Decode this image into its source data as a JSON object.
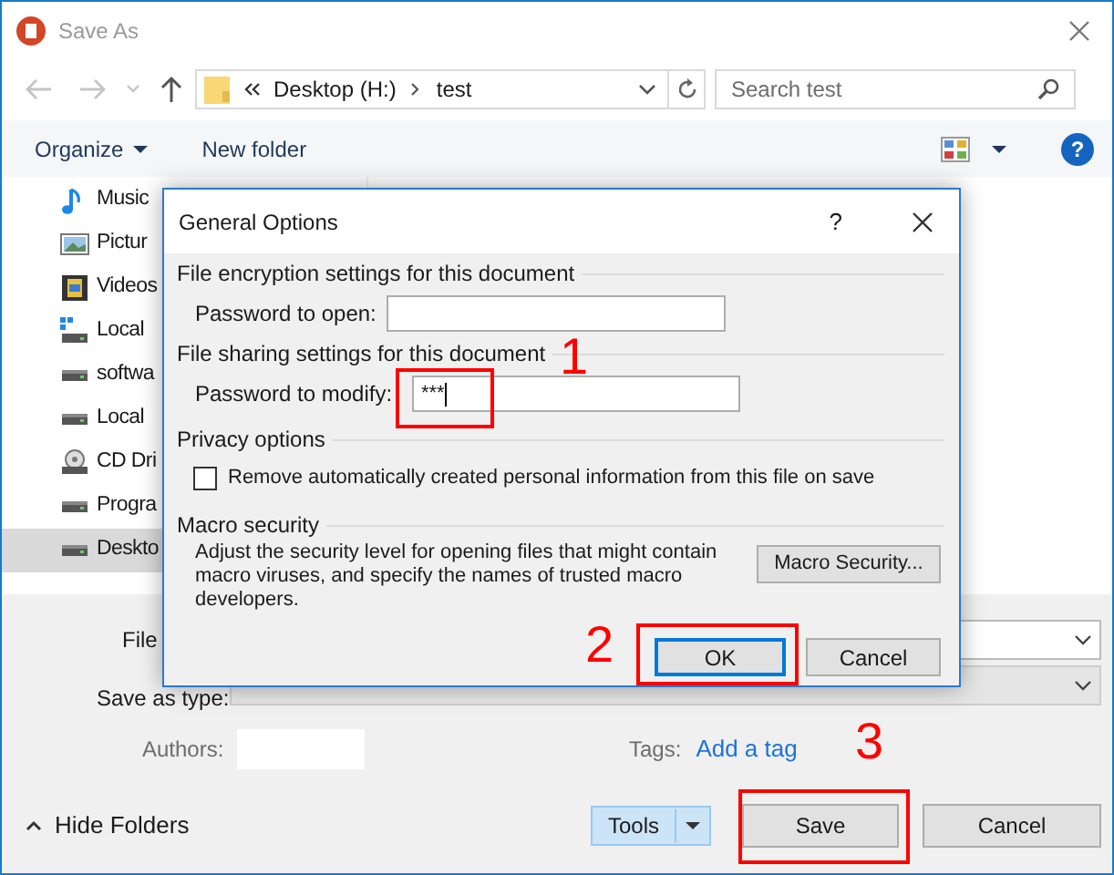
{
  "window": {
    "title": "Save As"
  },
  "navigation": {
    "breadcrumb": [
      "Desktop (H:)",
      "test"
    ],
    "search_placeholder": "Search test"
  },
  "toolbar": {
    "organize": "Organize",
    "new_folder": "New folder",
    "help": "?"
  },
  "sidebar": {
    "items": [
      {
        "label": "Music",
        "kind": "music",
        "selected": false
      },
      {
        "label": "Pictur",
        "kind": "pictures",
        "selected": false
      },
      {
        "label": "Videos",
        "kind": "videos",
        "selected": false
      },
      {
        "label": "Local",
        "kind": "systemdrive",
        "selected": false
      },
      {
        "label": "softwa",
        "kind": "drive",
        "selected": false
      },
      {
        "label": "Local",
        "kind": "drive",
        "selected": false
      },
      {
        "label": "CD Dri",
        "kind": "cd",
        "selected": false
      },
      {
        "label": "Progra",
        "kind": "drive",
        "selected": false
      },
      {
        "label": "Deskto",
        "kind": "drive",
        "selected": true
      }
    ]
  },
  "form": {
    "file_name_label": "File",
    "save_as_type_label": "Save as type:",
    "authors_label": "Authors:",
    "tags_label": "Tags:",
    "tags_link": "Add a tag"
  },
  "footer": {
    "hide_folders": "Hide Folders",
    "tools": "Tools",
    "save": "Save",
    "cancel": "Cancel"
  },
  "dialog": {
    "title": "General Options",
    "help": "?",
    "encryption_heading": "File encryption settings for this document",
    "password_open_label": "Password to open:",
    "sharing_heading": "File sharing settings for this document",
    "password_modify_label": "Password to modify:",
    "password_modify_value": "***",
    "privacy_heading": "Privacy options",
    "remove_info": {
      "label": "Remove automatically created personal information from this file on save",
      "checked": false
    },
    "macro_heading": "Macro security",
    "macro_text": "Adjust the security level for opening files that might contain macro viruses, and specify the names of trusted macro developers.",
    "macro_button": "Macro Security...",
    "ok": "OK",
    "cancel": "Cancel"
  },
  "annotations": [
    {
      "label": "1"
    },
    {
      "label": "2"
    },
    {
      "label": "3"
    }
  ]
}
